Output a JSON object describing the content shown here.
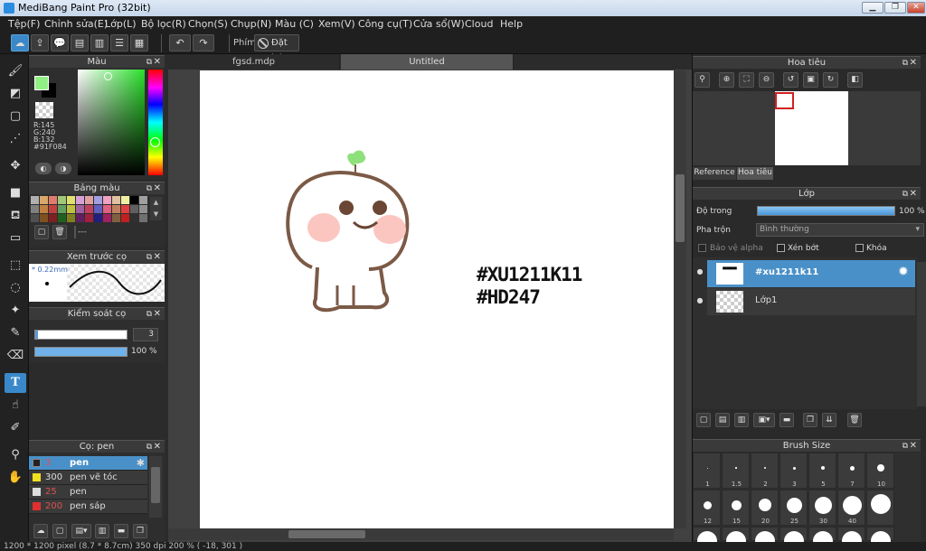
{
  "window": {
    "title": "MediBang Paint Pro (32bit)"
  },
  "menu": [
    "Tệp(F)",
    "Chỉnh sửa(E)",
    "Lớp(L)",
    "Bộ lọc(R)",
    "Chọn(S)",
    "Chụp(N)",
    "Màu (C)",
    "Xem(V)",
    "Công cụ(T)",
    "Cửa sổ(W)",
    "Cloud",
    "Help"
  ],
  "toolbar": {
    "phim_label": "Phím",
    "reset_label": "Đặt lại"
  },
  "color_panel": {
    "title": "Màu",
    "r": "R:145",
    "g": "G:240",
    "b": "B:132",
    "hex": "#91F084",
    "current_color": "#91f084"
  },
  "palette_panel": {
    "title": "Bảng màu",
    "extra": "---",
    "colors": [
      "#b0b0b0",
      "#d9a86c",
      "#e07c6c",
      "#a0c878",
      "#e0e070",
      "#d8a0d8",
      "#e0a0a0",
      "#a0a0e0",
      "#f0a0c0",
      "#e0c0a0",
      "#f0f0a0",
      "#000000",
      "#a0a0a0",
      "#808080",
      "#c08040",
      "#c04040",
      "#60a060",
      "#c0c040",
      "#a060a0",
      "#c04060",
      "#6060c0",
      "#e06080",
      "#c08060",
      "#e04040",
      "#606060",
      "#909090",
      "#505050",
      "#805020",
      "#802020",
      "#206020",
      "#808020",
      "#602060",
      "#a02040",
      "#202080",
      "#a02060",
      "#806040",
      "#c02020",
      "#303030",
      "#707070"
    ]
  },
  "preview_panel": {
    "title": "Xem trước cọ",
    "size": "0.22mm"
  },
  "brush_control": {
    "title": "Kiểm soát cọ",
    "size": "3",
    "opacity": "100 %"
  },
  "brush_panel": {
    "title": "Cọ: pen",
    "items": [
      {
        "color": "#222222",
        "size": "3",
        "name": "pen",
        "selected": true
      },
      {
        "color": "#f0e020",
        "size": "300",
        "name": "pen vẽ tóc"
      },
      {
        "color": "#dddddd",
        "size": "25",
        "name": "pen"
      },
      {
        "color": "#e03030",
        "size": "200",
        "name": "pen sáp"
      }
    ]
  },
  "tabs": [
    "fgsd.mdp",
    "Untitled"
  ],
  "canvas": {
    "text_line1": "#XU1211K11",
    "text_line2": "#HD247"
  },
  "navigator": {
    "title": "Hoa tiêu",
    "tab_reference": "Reference",
    "tab_navigator": "Hoa tiêu"
  },
  "layer_panel": {
    "title": "Lớp",
    "opacity_label": "Độ trong",
    "opacity_value": "100 %",
    "blend_label": "Pha trộn",
    "blend_value": "Bình thường",
    "protect_alpha": "Bảo vệ alpha",
    "clipping": "Xén bớt",
    "lock": "Khóa",
    "layers": [
      {
        "name": "#xu1211k11",
        "selected": true
      },
      {
        "name": "Lớp1"
      }
    ]
  },
  "brush_size_panel": {
    "title": "Brush Size",
    "sizes": [
      "1",
      "1.5",
      "2",
      "3",
      "5",
      "7",
      "10",
      "12",
      "15",
      "20",
      "25",
      "30",
      "40"
    ]
  },
  "status": "1200 * 1200 pixel   (8.7 * 8.7cm)   350 dpi   200 %   ( -18, 301 )"
}
